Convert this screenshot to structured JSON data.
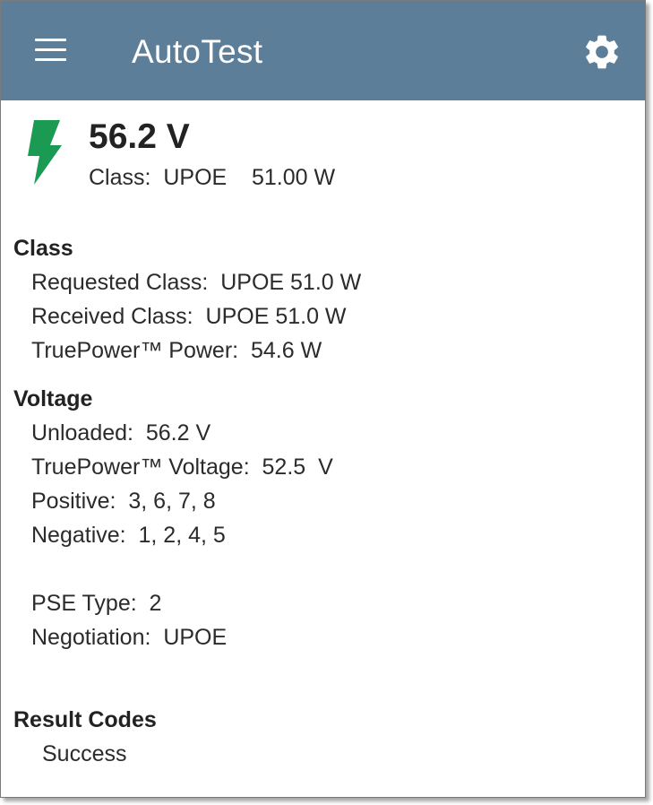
{
  "app_bar": {
    "title": "AutoTest",
    "menu_icon": "hamburger-menu-icon",
    "settings_icon": "gear-icon",
    "color": "#5c7e98"
  },
  "summary": {
    "status_icon": "lightning-bolt-icon",
    "status_color": "#1a9a52",
    "voltage": "56.2 V",
    "class_line": "Class:  UPOE    51.00 W"
  },
  "class_section": {
    "heading": "Class",
    "rows": [
      "Requested Class:  UPOE 51.0 W",
      "Received Class:  UPOE 51.0 W",
      "TruePower™ Power:  54.6 W"
    ]
  },
  "voltage_section": {
    "heading": "Voltage",
    "rows": [
      "Unloaded:  56.2 V",
      "TruePower™ Voltage:  52.5  V",
      "Positive:  3, 6, 7, 8",
      "Negative:  1, 2, 4, 5"
    ],
    "extra_rows": [
      "PSE Type:  2",
      "Negotiation:  UPOE"
    ]
  },
  "result_section": {
    "heading": "Result Codes",
    "rows": [
      "Success"
    ]
  }
}
